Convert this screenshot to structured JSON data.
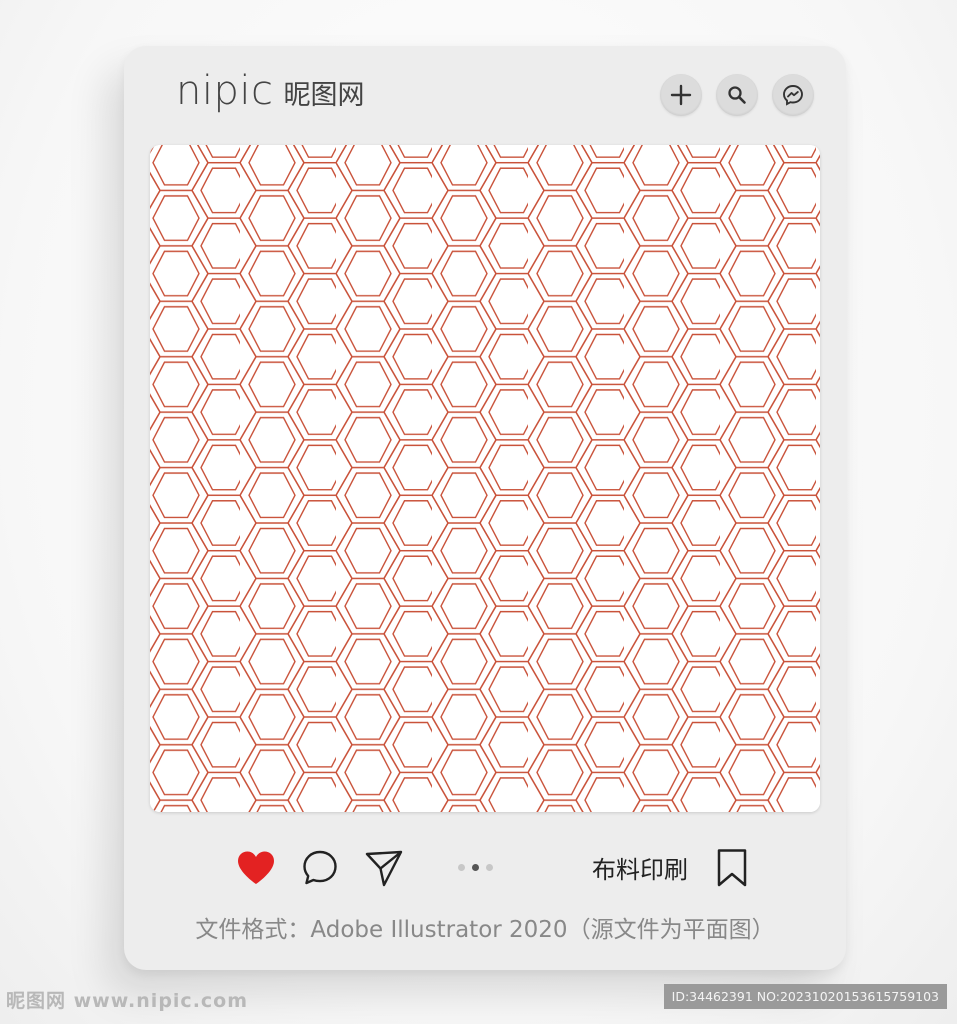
{
  "brand": {
    "name_en": "nipic",
    "name_cn": "昵图网"
  },
  "top_actions": [
    {
      "name": "add",
      "icon": "plus-icon"
    },
    {
      "name": "search",
      "icon": "search-icon"
    },
    {
      "name": "messenger",
      "icon": "messenger-icon"
    }
  ],
  "pattern": {
    "line_color": "#c9523a",
    "background": "#ffffff"
  },
  "actions": {
    "like_color": "#e32222",
    "pagination": {
      "total": 3,
      "current": 2
    }
  },
  "category_label": "布料印刷",
  "format_text": "文件格式：Adobe Illustrator 2020（源文件为平面图）",
  "watermark_left": "昵图网 www.nipic.com",
  "watermark_right": "ID:34462391 NO:20231020153615759103"
}
